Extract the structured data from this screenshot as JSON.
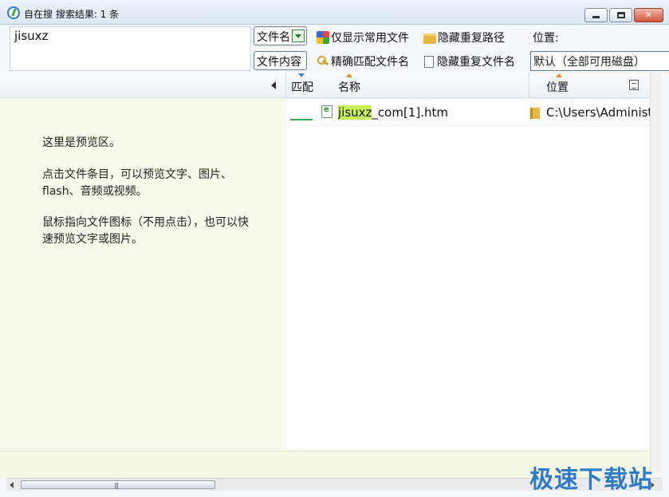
{
  "window": {
    "title": "自在搜 搜索结果: 1 条",
    "icon": "app-logo-icon"
  },
  "toolbar": {
    "search_value": "jisuxz",
    "filename_btn": "文件名",
    "content_btn": "文件内容",
    "opt_common_files": "仅显示常用文件",
    "opt_exact_match": "精确匹配文件名",
    "opt_hide_dup_path": "隐藏重复路径",
    "opt_hide_dup_name": "隐藏重复文件名",
    "location_label": "位置:",
    "location_value": "默认（全部可用磁盘）"
  },
  "columns": {
    "match": "匹配",
    "name": "名称",
    "location": "位置"
  },
  "preview": {
    "line1": "这里是预览区。",
    "line2": "点击文件条目，可以预览文字、图片、flash、音频或视频。",
    "line3": "鼠标指向文件图标（不用点击），也可以快速预览文字或图片。"
  },
  "results": [
    {
      "name_highlight": "jisuxz",
      "name_rest": "_com[1].htm",
      "location": "C:\\Users\\Administ",
      "icon": "htm-file-icon"
    }
  ],
  "watermark": "极速下载站",
  "colors": {
    "highlight": "#c9f25a",
    "preview_bg": "#f8f9ed",
    "match_bar": "#3aa657"
  }
}
